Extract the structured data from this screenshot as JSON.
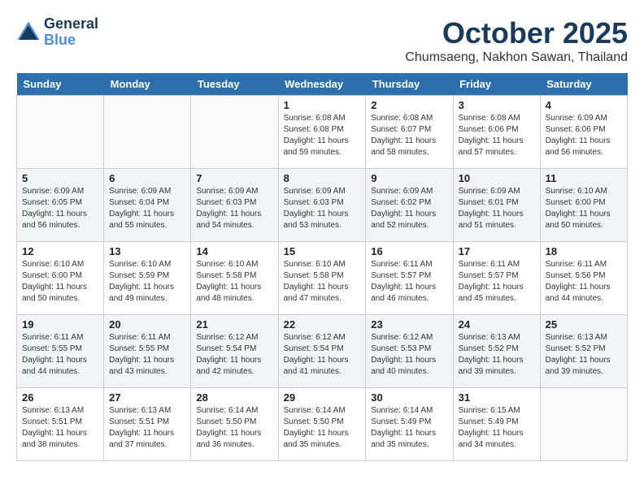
{
  "header": {
    "logo_line1": "General",
    "logo_line2": "Blue",
    "month": "October 2025",
    "location": "Chumsaeng, Nakhon Sawan, Thailand"
  },
  "weekdays": [
    "Sunday",
    "Monday",
    "Tuesday",
    "Wednesday",
    "Thursday",
    "Friday",
    "Saturday"
  ],
  "weeks": [
    [
      {
        "day": "",
        "info": ""
      },
      {
        "day": "",
        "info": ""
      },
      {
        "day": "",
        "info": ""
      },
      {
        "day": "1",
        "info": "Sunrise: 6:08 AM\nSunset: 6:08 PM\nDaylight: 11 hours\nand 59 minutes."
      },
      {
        "day": "2",
        "info": "Sunrise: 6:08 AM\nSunset: 6:07 PM\nDaylight: 11 hours\nand 58 minutes."
      },
      {
        "day": "3",
        "info": "Sunrise: 6:08 AM\nSunset: 6:06 PM\nDaylight: 11 hours\nand 57 minutes."
      },
      {
        "day": "4",
        "info": "Sunrise: 6:09 AM\nSunset: 6:06 PM\nDaylight: 11 hours\nand 56 minutes."
      }
    ],
    [
      {
        "day": "5",
        "info": "Sunrise: 6:09 AM\nSunset: 6:05 PM\nDaylight: 11 hours\nand 56 minutes."
      },
      {
        "day": "6",
        "info": "Sunrise: 6:09 AM\nSunset: 6:04 PM\nDaylight: 11 hours\nand 55 minutes."
      },
      {
        "day": "7",
        "info": "Sunrise: 6:09 AM\nSunset: 6:03 PM\nDaylight: 11 hours\nand 54 minutes."
      },
      {
        "day": "8",
        "info": "Sunrise: 6:09 AM\nSunset: 6:03 PM\nDaylight: 11 hours\nand 53 minutes."
      },
      {
        "day": "9",
        "info": "Sunrise: 6:09 AM\nSunset: 6:02 PM\nDaylight: 11 hours\nand 52 minutes."
      },
      {
        "day": "10",
        "info": "Sunrise: 6:09 AM\nSunset: 6:01 PM\nDaylight: 11 hours\nand 51 minutes."
      },
      {
        "day": "11",
        "info": "Sunrise: 6:10 AM\nSunset: 6:00 PM\nDaylight: 11 hours\nand 50 minutes."
      }
    ],
    [
      {
        "day": "12",
        "info": "Sunrise: 6:10 AM\nSunset: 6:00 PM\nDaylight: 11 hours\nand 50 minutes."
      },
      {
        "day": "13",
        "info": "Sunrise: 6:10 AM\nSunset: 5:59 PM\nDaylight: 11 hours\nand 49 minutes."
      },
      {
        "day": "14",
        "info": "Sunrise: 6:10 AM\nSunset: 5:58 PM\nDaylight: 11 hours\nand 48 minutes."
      },
      {
        "day": "15",
        "info": "Sunrise: 6:10 AM\nSunset: 5:58 PM\nDaylight: 11 hours\nand 47 minutes."
      },
      {
        "day": "16",
        "info": "Sunrise: 6:11 AM\nSunset: 5:57 PM\nDaylight: 11 hours\nand 46 minutes."
      },
      {
        "day": "17",
        "info": "Sunrise: 6:11 AM\nSunset: 5:57 PM\nDaylight: 11 hours\nand 45 minutes."
      },
      {
        "day": "18",
        "info": "Sunrise: 6:11 AM\nSunset: 5:56 PM\nDaylight: 11 hours\nand 44 minutes."
      }
    ],
    [
      {
        "day": "19",
        "info": "Sunrise: 6:11 AM\nSunset: 5:55 PM\nDaylight: 11 hours\nand 44 minutes."
      },
      {
        "day": "20",
        "info": "Sunrise: 6:11 AM\nSunset: 5:55 PM\nDaylight: 11 hours\nand 43 minutes."
      },
      {
        "day": "21",
        "info": "Sunrise: 6:12 AM\nSunset: 5:54 PM\nDaylight: 11 hours\nand 42 minutes."
      },
      {
        "day": "22",
        "info": "Sunrise: 6:12 AM\nSunset: 5:54 PM\nDaylight: 11 hours\nand 41 minutes."
      },
      {
        "day": "23",
        "info": "Sunrise: 6:12 AM\nSunset: 5:53 PM\nDaylight: 11 hours\nand 40 minutes."
      },
      {
        "day": "24",
        "info": "Sunrise: 6:13 AM\nSunset: 5:52 PM\nDaylight: 11 hours\nand 39 minutes."
      },
      {
        "day": "25",
        "info": "Sunrise: 6:13 AM\nSunset: 5:52 PM\nDaylight: 11 hours\nand 39 minutes."
      }
    ],
    [
      {
        "day": "26",
        "info": "Sunrise: 6:13 AM\nSunset: 5:51 PM\nDaylight: 11 hours\nand 38 minutes."
      },
      {
        "day": "27",
        "info": "Sunrise: 6:13 AM\nSunset: 5:51 PM\nDaylight: 11 hours\nand 37 minutes."
      },
      {
        "day": "28",
        "info": "Sunrise: 6:14 AM\nSunset: 5:50 PM\nDaylight: 11 hours\nand 36 minutes."
      },
      {
        "day": "29",
        "info": "Sunrise: 6:14 AM\nSunset: 5:50 PM\nDaylight: 11 hours\nand 35 minutes."
      },
      {
        "day": "30",
        "info": "Sunrise: 6:14 AM\nSunset: 5:49 PM\nDaylight: 11 hours\nand 35 minutes."
      },
      {
        "day": "31",
        "info": "Sunrise: 6:15 AM\nSunset: 5:49 PM\nDaylight: 11 hours\nand 34 minutes."
      },
      {
        "day": "",
        "info": ""
      }
    ]
  ]
}
